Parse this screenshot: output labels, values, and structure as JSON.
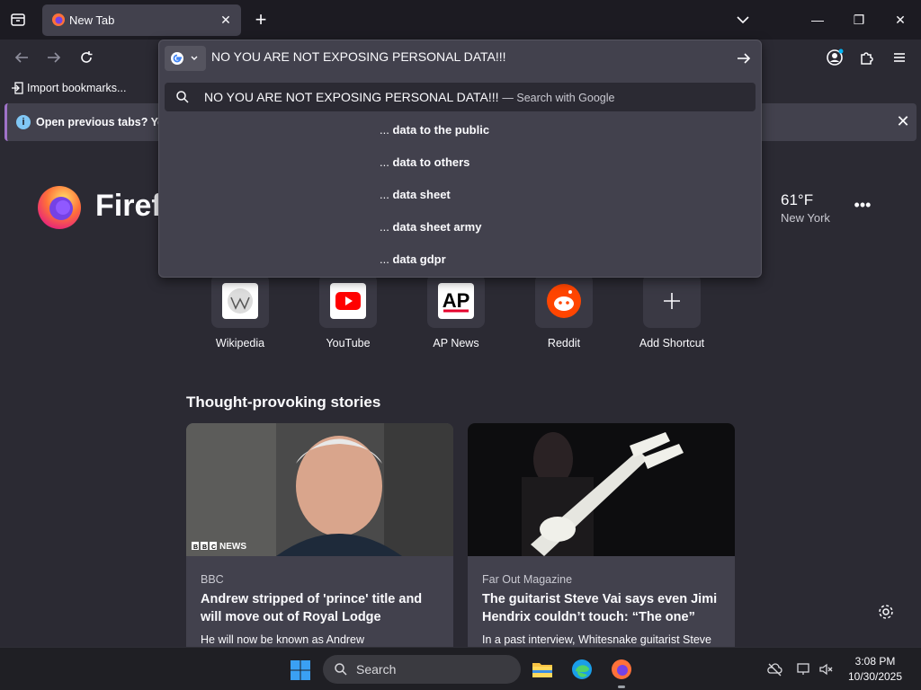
{
  "tab": {
    "title": "New Tab"
  },
  "toolbar": {
    "import_bookmarks": "Import bookmarks..."
  },
  "notification": {
    "text": "Open previous tabs? You c"
  },
  "urlbar": {
    "value": "NO YOU ARE NOT EXPOSING PERSONAL DATA!!!",
    "search_row_query": "NO YOU ARE NOT EXPOSING PERSONAL DATA!!!",
    "search_row_hint": "— Search with Google",
    "suggestions": [
      {
        "prefix": "... ",
        "rest": "data to the public"
      },
      {
        "prefix": "... ",
        "rest": "data to others"
      },
      {
        "prefix": "... ",
        "rest": "data sheet"
      },
      {
        "prefix": "... ",
        "rest": "data sheet army"
      },
      {
        "prefix": "... ",
        "rest": "data gdpr"
      }
    ]
  },
  "brand": {
    "wordmark": "Firef"
  },
  "weather": {
    "temp": "61°F",
    "city": "New York"
  },
  "shortcuts": [
    {
      "label": "Wikipedia",
      "icon": "wikipedia-icon"
    },
    {
      "label": "YouTube",
      "icon": "youtube-icon"
    },
    {
      "label": "AP News",
      "icon": "ap-news-icon"
    },
    {
      "label": "Reddit",
      "icon": "reddit-icon"
    },
    {
      "label": "Add Shortcut",
      "icon": "plus-icon"
    }
  ],
  "stories": {
    "title": "Thought-provoking stories",
    "cards": [
      {
        "source": "BBC",
        "title": "Andrew stripped of 'prince' title and will move out of Royal Lodge",
        "desc": "He will now be known as Andrew",
        "badge": "NEWS"
      },
      {
        "source": "Far Out Magazine",
        "title": "The guitarist Steve Vai says even Jimi Hendrix couldn’t touch: “The one”",
        "desc": "In a past interview, Whitesnake guitarist Steve"
      }
    ]
  },
  "taskbar": {
    "search": "Search",
    "time": "3:08 PM",
    "date": "10/30/2025"
  },
  "colors": {
    "accent": "#a073c9",
    "bg": "#2b2a33",
    "panel": "#42414d"
  }
}
